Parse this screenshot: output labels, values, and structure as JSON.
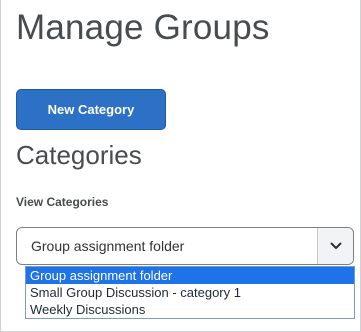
{
  "page": {
    "title": "Manage Groups"
  },
  "toolbar": {
    "new_category_label": "New Category"
  },
  "categories_section": {
    "heading": "Categories",
    "view_label": "View Categories"
  },
  "category_select": {
    "selected_value": "Group assignment folder",
    "options": [
      {
        "label": "Group assignment folder",
        "selected": true
      },
      {
        "label": "Small Group Discussion - category 1",
        "selected": false
      },
      {
        "label": "Weekly Discussions",
        "selected": false
      }
    ]
  },
  "icons": {
    "select_toggle": "chevron-down-icon"
  },
  "colors": {
    "primary_button": "#2d71c7",
    "highlight": "#1e73e8",
    "heading_text": "#494c4e"
  }
}
